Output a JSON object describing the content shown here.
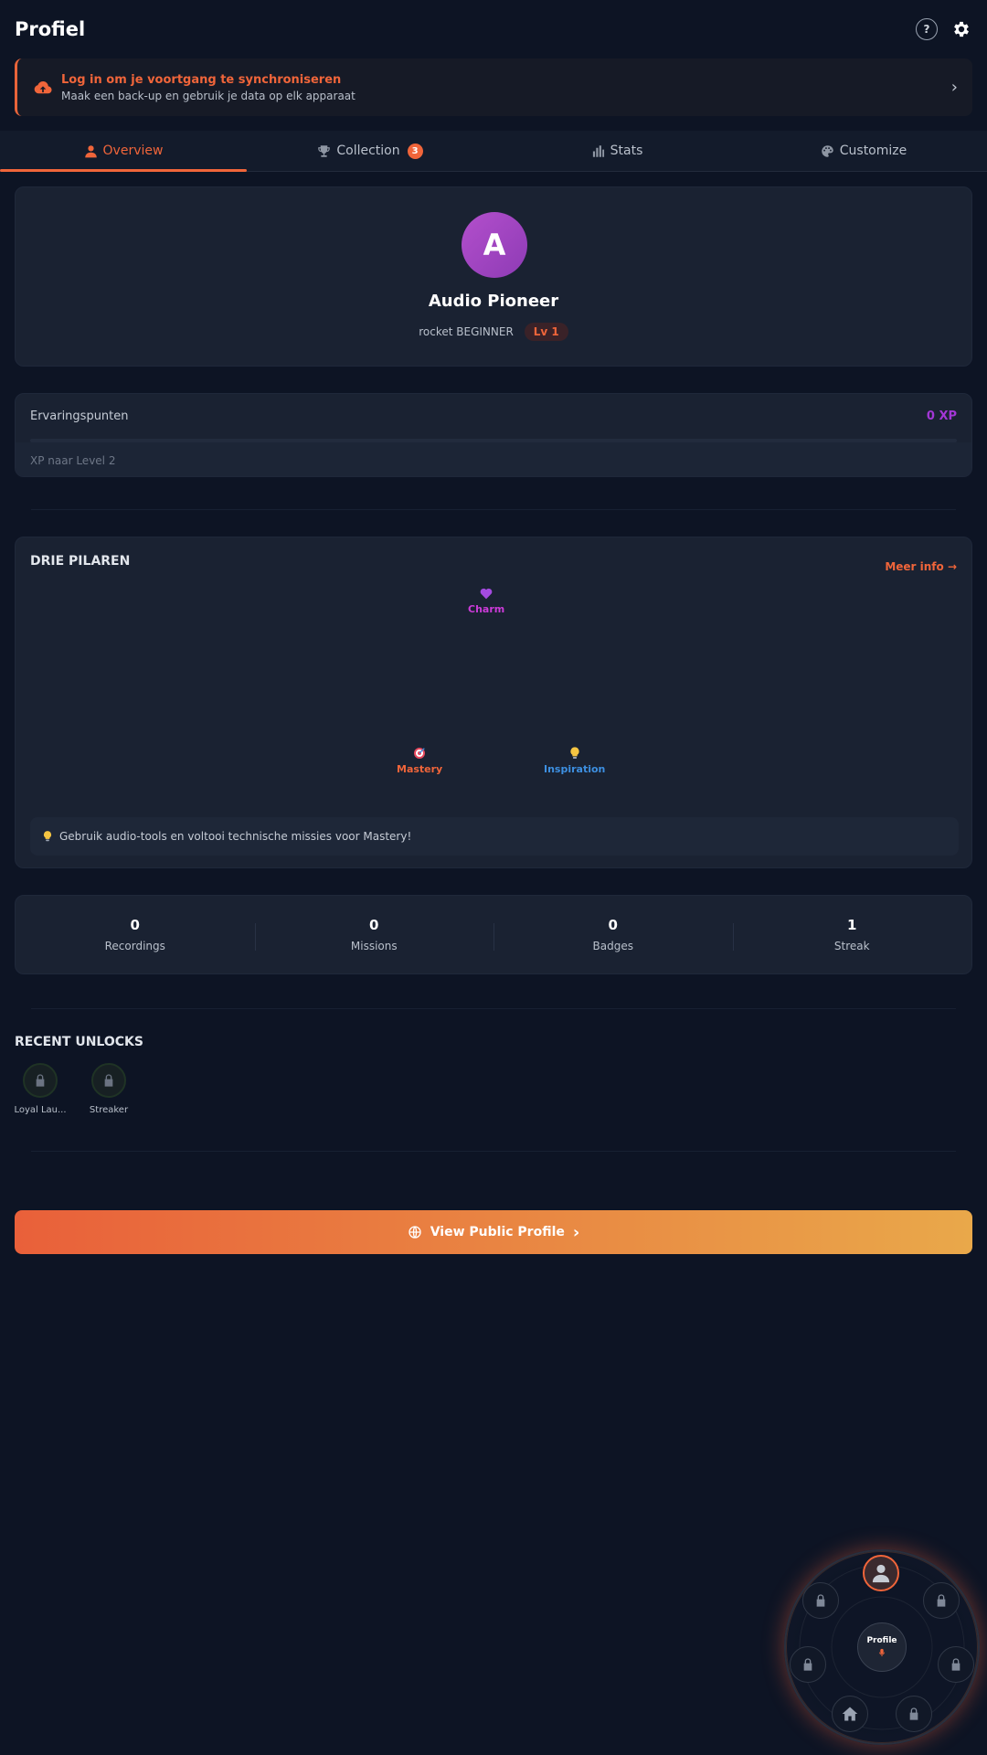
{
  "header": {
    "title": "Profiel",
    "help_label": "?"
  },
  "sync_banner": {
    "title": "Log in om je voortgang te synchroniseren",
    "subtitle": "Maak een back-up en gebruik je data op elk apparaat"
  },
  "tabs": [
    {
      "label": "Overview",
      "active": true
    },
    {
      "label": "Collection",
      "badge": "3"
    },
    {
      "label": "Stats"
    },
    {
      "label": "Customize"
    }
  ],
  "profile": {
    "avatar_letter": "A",
    "name": "Audio Pioneer",
    "rank": "rocket BEGINNER",
    "level": "Lv 1"
  },
  "xp": {
    "label": "Ervaringspunten",
    "value": "0 XP",
    "progress": 0,
    "next_level": "XP naar Level 2"
  },
  "pillars": {
    "title": "DRIE PILAREN",
    "more_info": "Meer info →",
    "items": [
      {
        "name": "Charm",
        "color": "#cc3bd9"
      },
      {
        "name": "Mastery",
        "color": "#f0653a"
      },
      {
        "name": "Inspiration",
        "color": "#3d8fe0"
      }
    ],
    "tip": "Gebruik audio-tools en voltooi technische missies voor Mastery!"
  },
  "stats": [
    {
      "value": "0",
      "label": "Recordings"
    },
    {
      "value": "0",
      "label": "Missions"
    },
    {
      "value": "0",
      "label": "Badges"
    },
    {
      "value": "1",
      "label": "Streak"
    }
  ],
  "recent_unlocks": {
    "title": "RECENT UNLOCKS",
    "items": [
      {
        "label": "Loyal Lau..."
      },
      {
        "label": "Streaker"
      }
    ]
  },
  "cta": {
    "label": "View Public Profile"
  },
  "radial_menu": {
    "center_label": "Profile"
  },
  "colors": {
    "accent": "#f0653a",
    "xp": "#a337d6",
    "background": "#0d1424"
  }
}
